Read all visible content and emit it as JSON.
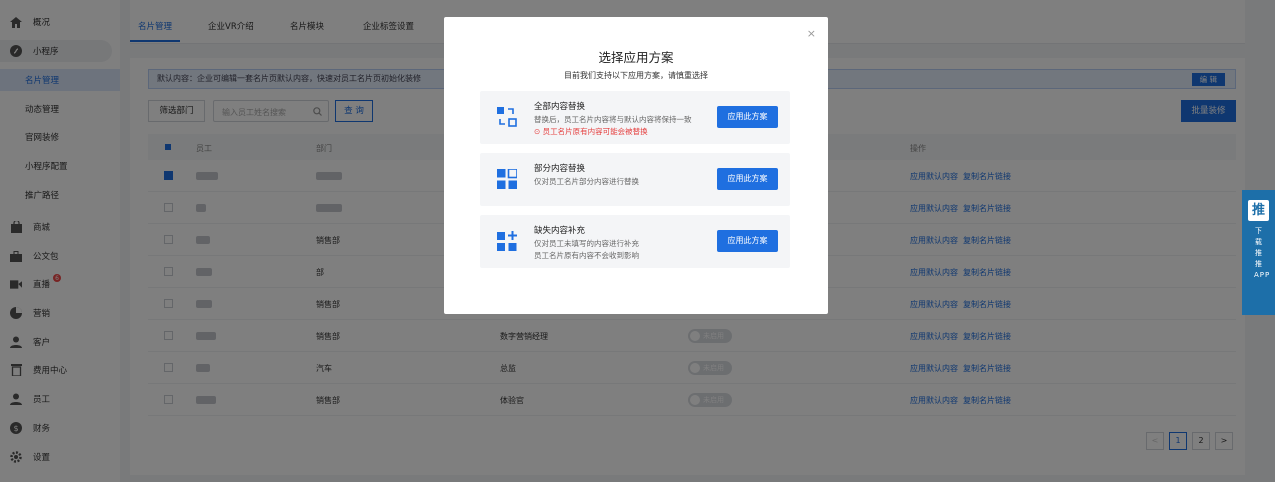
{
  "sidebar": {
    "items": [
      {
        "label": "概况",
        "icon": "home-icon"
      },
      {
        "label": "小程序",
        "icon": "miniapp-icon"
      },
      {
        "label": "名片管理"
      },
      {
        "label": "动态管理"
      },
      {
        "label": "官网装修"
      },
      {
        "label": "小程序配置"
      },
      {
        "label": "推广路径"
      },
      {
        "label": "商城",
        "icon": "bag-icon"
      },
      {
        "label": "公文包",
        "icon": "briefcase-icon"
      },
      {
        "label": "直播",
        "icon": "live-icon",
        "badge": "6"
      },
      {
        "label": "营销",
        "icon": "pie-icon"
      },
      {
        "label": "客户",
        "icon": "customer-icon"
      },
      {
        "label": "费用中心",
        "icon": "trash-icon"
      },
      {
        "label": "员工",
        "icon": "user-icon"
      },
      {
        "label": "财务",
        "icon": "finance-icon"
      },
      {
        "label": "设置",
        "icon": "gear-icon"
      }
    ]
  },
  "tabs": [
    "名片管理",
    "企业VR介绍",
    "名片模块",
    "企业标签设置"
  ],
  "notice": {
    "text": "默认内容：企业可编辑一套名片页默认内容，快速对员工名片页初始化装修",
    "edit": "编 辑"
  },
  "toolbar": {
    "filter": "筛选部门",
    "search_placeholder": "输入员工姓名搜索",
    "query": "查 询",
    "batch": "批量装修"
  },
  "table": {
    "headers": [
      "员工",
      "部门",
      "操作"
    ],
    "rows": [
      {
        "dept": "",
        "title": "",
        "status": "",
        "checked": true
      },
      {
        "dept": "",
        "title": "",
        "status": "",
        "checked": false
      },
      {
        "dept": "销售部",
        "title": "",
        "status": "",
        "checked": false
      },
      {
        "dept": "部",
        "title": "",
        "status": "",
        "checked": false
      },
      {
        "dept": "销售部",
        "title": "",
        "status": "",
        "checked": false
      },
      {
        "dept": "销售部",
        "title": "数字营销经理",
        "status": "未启用",
        "checked": false
      },
      {
        "dept": "汽车",
        "title": "总监",
        "status": "未启用",
        "checked": false
      },
      {
        "dept": "销售部",
        "title": "体验官",
        "status": "未启用",
        "checked": false
      }
    ],
    "action1": "应用默认内容",
    "action2": "复制名片链接"
  },
  "pager": {
    "prev": "<",
    "p1": "1",
    "p2": "2",
    "next": ">"
  },
  "side_tag": {
    "logo": "推",
    "text": "下载推推APP"
  },
  "modal": {
    "close": "×",
    "title": "选择应用方案",
    "subtitle": "目前我们支持以下应用方案，请慎重选择",
    "options": [
      {
        "title": "全部内容替换",
        "desc": "替换后，员工名片内容将与默认内容将保持一致",
        "warn": "员工名片原有内容可能会被替换",
        "button": "应用此方案",
        "icon": "replace-all-icon"
      },
      {
        "title": "部分内容替换",
        "desc": "仅对员工名片部分内容进行替换",
        "button": "应用此方案",
        "icon": "grid-icon"
      },
      {
        "title": "缺失内容补充",
        "desc": "仅对员工未填写的内容进行补充",
        "desc2": "员工名片原有内容不会收到影响",
        "button": "应用此方案",
        "icon": "grid-plus-icon"
      }
    ]
  },
  "colors": {
    "accent": "#1f6fe0",
    "warn": "#e53e3e",
    "side_tag": "#1d6fa9"
  }
}
